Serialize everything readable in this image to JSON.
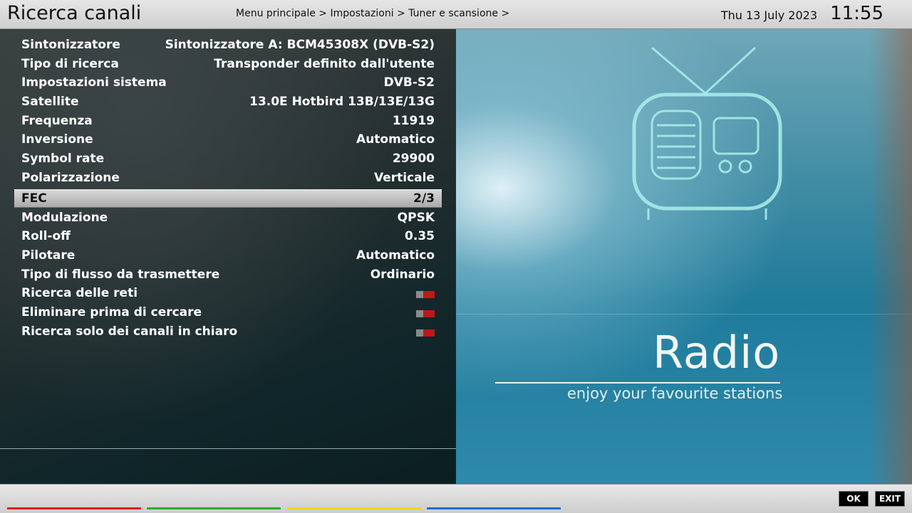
{
  "header": {
    "title": "Ricerca canali",
    "breadcrumb": "Menu principale > Impostazioni > Tuner e scansione >",
    "date": "Thu 13 July 2023",
    "time": "11:55"
  },
  "settings": [
    {
      "label": "Sintonizzatore",
      "value": "Sintonizzatore A: BCM45308X (DVB-S2)"
    },
    {
      "label": "Tipo di ricerca",
      "value": "Transponder definito dall'utente"
    },
    {
      "label": "Impostazioni sistema",
      "value": "DVB-S2"
    },
    {
      "label": "Satellite",
      "value": "13.0E Hotbird 13B/13E/13G"
    },
    {
      "label": "Frequenza",
      "value": "11919"
    },
    {
      "label": "Inversione",
      "value": "Automatico"
    },
    {
      "label": "Symbol rate",
      "value": "29900"
    },
    {
      "label": "Polarizzazione",
      "value": "Verticale"
    },
    {
      "label": "FEC",
      "value": "2/3"
    },
    {
      "label": "Modulazione",
      "value": "QPSK"
    },
    {
      "label": "Roll-off",
      "value": "0.35"
    },
    {
      "label": "Pilotare",
      "value": "Automatico"
    },
    {
      "label": "Tipo di flusso da trasmettere",
      "value": "Ordinario"
    }
  ],
  "toggles": [
    {
      "label": "Ricerca delle reti",
      "state": "off"
    },
    {
      "label": "Eliminare prima di cercare",
      "state": "off"
    },
    {
      "label": "Ricerca solo dei canali in chiaro",
      "state": "off"
    }
  ],
  "selected_index": 8,
  "promo": {
    "title": "Radio",
    "subtitle": "enjoy your favourite stations",
    "icon": "retro-tv-icon"
  },
  "footer": {
    "ok_label": "OK",
    "exit_label": "EXIT",
    "color_keys": [
      "#e0201c",
      "#2ea82e",
      "#e8d81a",
      "#1c6fd0"
    ]
  }
}
